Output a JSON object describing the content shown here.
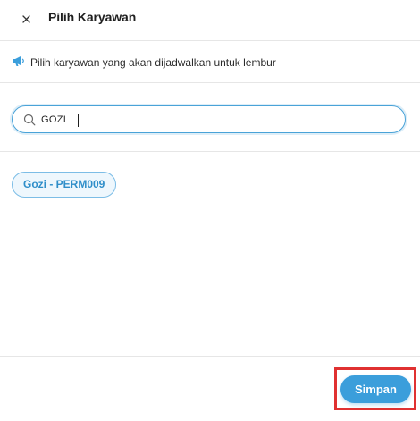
{
  "header": {
    "close_icon": "close-icon",
    "title": "Pilih Karyawan"
  },
  "info": {
    "icon": "megaphone-icon",
    "text": "Pilih karyawan yang akan dijadwalkan untuk lembur"
  },
  "search": {
    "icon": "search-icon",
    "value": "GOZI",
    "placeholder": ""
  },
  "results": [
    {
      "label": "Gozi - PERM009"
    }
  ],
  "footer": {
    "save_label": "Simpan"
  },
  "colors": {
    "accent": "#3b9edb",
    "chip_text": "#2f8ec9",
    "highlight": "#e03131"
  }
}
